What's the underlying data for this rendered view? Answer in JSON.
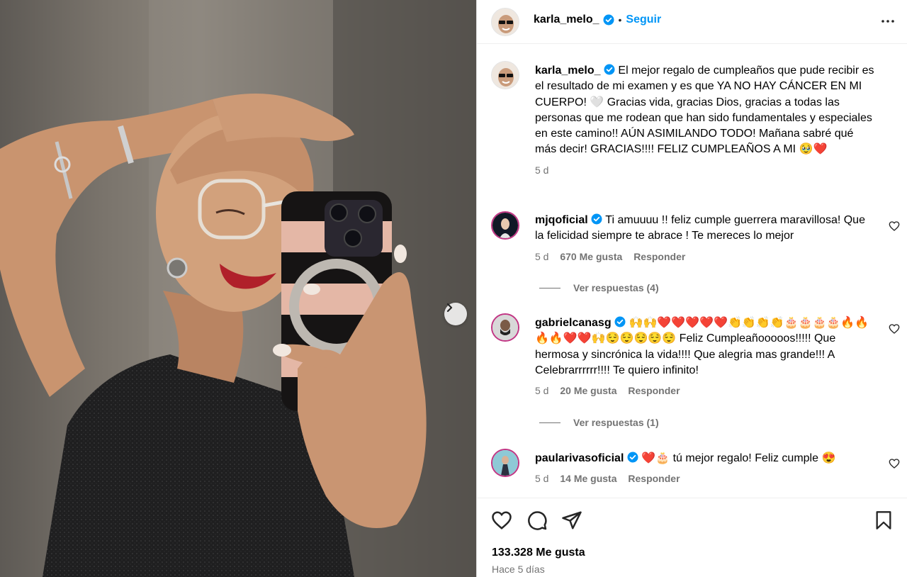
{
  "post": {
    "username": "karla_melo_",
    "follow_label": "Seguir",
    "separator": "•"
  },
  "caption": {
    "username": "karla_melo_",
    "text": "El mejor regalo de cumpleaños que pude recibir es el resultado de mi examen y es que YA NO HAY CÁNCER EN MI CUERPO! 🤍 Gracias vida, gracias Dios, gracias a todas las personas que me rodean que han sido fundamentales y especiales en este camino!! AÚN ASIMILANDO TODO! Mañana sabré qué más decir! GRACIAS!!!! FELIZ CUMPLEAÑOS A MI 🥹❤️",
    "age": "5 d"
  },
  "comments": [
    {
      "username": "mjqoficial",
      "text": "Ti amuuuu !! feliz cumple guerrera maravillosa! Que la felicidad siempre te abrace ! Te mereces lo mejor",
      "age": "5 d",
      "likes": "670 Me gusta",
      "reply": "Responder",
      "view_replies": "Ver respuestas (4)"
    },
    {
      "username": "gabrielcanasg",
      "text": "🙌🙌❤️❤️❤️❤️❤️👏👏👏👏🎂🎂🎂🎂🔥🔥🔥🔥❤️❤️🙌😌😌😌😌😌 Feliz Cumpleañooooos!!!!! Que hermosa y sincrónica la vida!!!! Que alegria mas grande!!! A Celebrarrrrrr!!!! Te quiero infinito!",
      "age": "5 d",
      "likes": "20 Me gusta",
      "reply": "Responder",
      "view_replies": "Ver respuestas (1)"
    },
    {
      "username": "paularivasoficial",
      "text": "❤️🎂 tú mejor regalo! Feliz cumple 😍",
      "age": "5 d",
      "likes": "14 Me gusta",
      "reply": "Responder"
    }
  ],
  "footer": {
    "likes": "133.328 Me gusta",
    "time": "Hace 5 días"
  },
  "icons": {
    "verified": "verified-badge-icon",
    "more": "more-options-icon",
    "like": "heart-icon",
    "comment": "comment-icon",
    "share": "share-icon",
    "save": "bookmark-icon",
    "next": "chevron-right-icon"
  },
  "colors": {
    "accent": "#0095f6",
    "muted": "#737373",
    "border": "#dbdbdb"
  }
}
